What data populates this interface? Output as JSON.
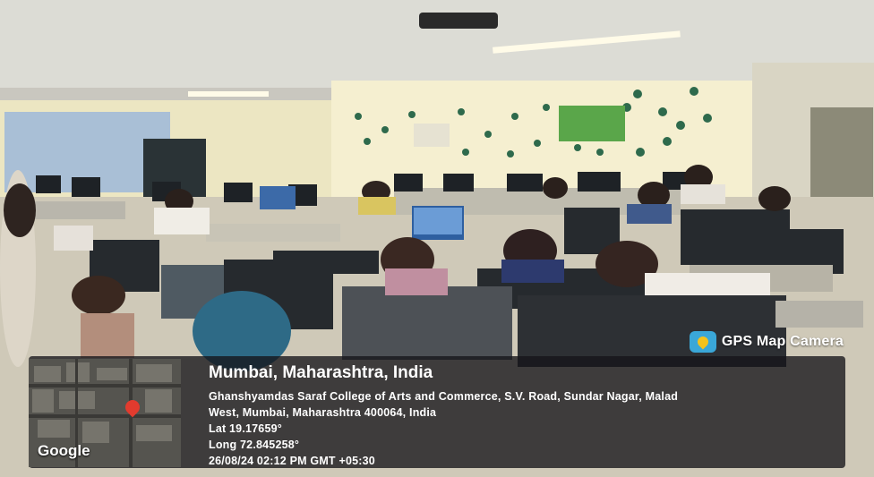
{
  "app": {
    "name": "GPS Map Camera",
    "logo_icon": "map-pin-camera-icon"
  },
  "map": {
    "brand": "Google",
    "pin_icon": "location-pin-icon"
  },
  "location": {
    "city": "Mumbai, Maharashtra, India",
    "address_line1": "Ghanshyamdas Saraf College of Arts and Commerce, S.V. Road, Sundar Nagar, Malad",
    "address_line2": "West, Mumbai, Maharashtra 400064, India",
    "lat": "Lat 19.17659°",
    "long": "Long 72.845258°",
    "datetime": "26/08/24 02:12 PM GMT +05:30"
  },
  "colors": {
    "wall": "#f3ecc8",
    "ceiling": "#dcdcd5",
    "overlay": "#14141a",
    "brand_blue": "#3aa7d8",
    "pin_red": "#e23b2e",
    "wall_dot": "#2e6a4c"
  }
}
